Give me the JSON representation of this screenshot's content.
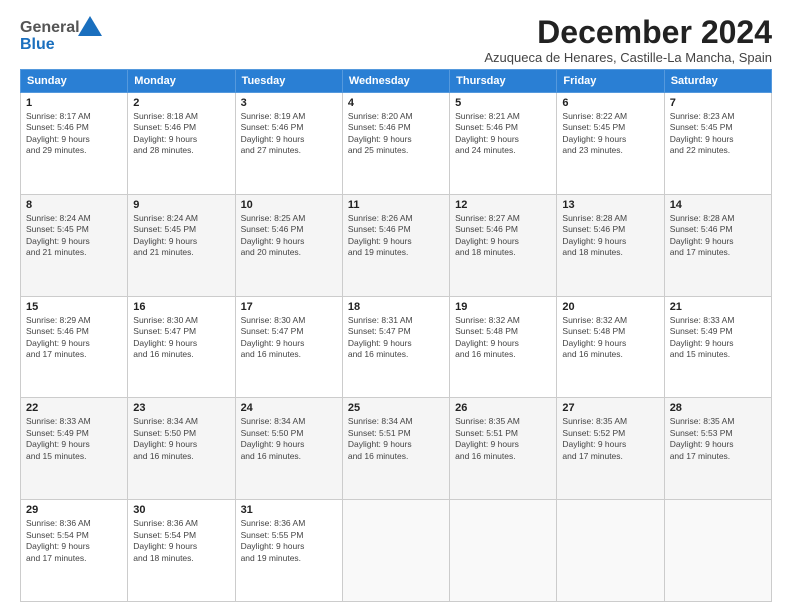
{
  "header": {
    "logo": {
      "line1": "General",
      "line2": "Blue"
    },
    "title": "December 2024",
    "location": "Azuqueca de Henares, Castille-La Mancha, Spain"
  },
  "weekdays": [
    "Sunday",
    "Monday",
    "Tuesday",
    "Wednesday",
    "Thursday",
    "Friday",
    "Saturday"
  ],
  "weeks": [
    [
      {
        "day": "1",
        "info": "Sunrise: 8:17 AM\nSunset: 5:46 PM\nDaylight: 9 hours\nand 29 minutes."
      },
      {
        "day": "2",
        "info": "Sunrise: 8:18 AM\nSunset: 5:46 PM\nDaylight: 9 hours\nand 28 minutes."
      },
      {
        "day": "3",
        "info": "Sunrise: 8:19 AM\nSunset: 5:46 PM\nDaylight: 9 hours\nand 27 minutes."
      },
      {
        "day": "4",
        "info": "Sunrise: 8:20 AM\nSunset: 5:46 PM\nDaylight: 9 hours\nand 25 minutes."
      },
      {
        "day": "5",
        "info": "Sunrise: 8:21 AM\nSunset: 5:46 PM\nDaylight: 9 hours\nand 24 minutes."
      },
      {
        "day": "6",
        "info": "Sunrise: 8:22 AM\nSunset: 5:45 PM\nDaylight: 9 hours\nand 23 minutes."
      },
      {
        "day": "7",
        "info": "Sunrise: 8:23 AM\nSunset: 5:45 PM\nDaylight: 9 hours\nand 22 minutes."
      }
    ],
    [
      {
        "day": "8",
        "info": "Sunrise: 8:24 AM\nSunset: 5:45 PM\nDaylight: 9 hours\nand 21 minutes."
      },
      {
        "day": "9",
        "info": "Sunrise: 8:24 AM\nSunset: 5:45 PM\nDaylight: 9 hours\nand 21 minutes."
      },
      {
        "day": "10",
        "info": "Sunrise: 8:25 AM\nSunset: 5:46 PM\nDaylight: 9 hours\nand 20 minutes."
      },
      {
        "day": "11",
        "info": "Sunrise: 8:26 AM\nSunset: 5:46 PM\nDaylight: 9 hours\nand 19 minutes."
      },
      {
        "day": "12",
        "info": "Sunrise: 8:27 AM\nSunset: 5:46 PM\nDaylight: 9 hours\nand 18 minutes."
      },
      {
        "day": "13",
        "info": "Sunrise: 8:28 AM\nSunset: 5:46 PM\nDaylight: 9 hours\nand 18 minutes."
      },
      {
        "day": "14",
        "info": "Sunrise: 8:28 AM\nSunset: 5:46 PM\nDaylight: 9 hours\nand 17 minutes."
      }
    ],
    [
      {
        "day": "15",
        "info": "Sunrise: 8:29 AM\nSunset: 5:46 PM\nDaylight: 9 hours\nand 17 minutes."
      },
      {
        "day": "16",
        "info": "Sunrise: 8:30 AM\nSunset: 5:47 PM\nDaylight: 9 hours\nand 16 minutes."
      },
      {
        "day": "17",
        "info": "Sunrise: 8:30 AM\nSunset: 5:47 PM\nDaylight: 9 hours\nand 16 minutes."
      },
      {
        "day": "18",
        "info": "Sunrise: 8:31 AM\nSunset: 5:47 PM\nDaylight: 9 hours\nand 16 minutes."
      },
      {
        "day": "19",
        "info": "Sunrise: 8:32 AM\nSunset: 5:48 PM\nDaylight: 9 hours\nand 16 minutes."
      },
      {
        "day": "20",
        "info": "Sunrise: 8:32 AM\nSunset: 5:48 PM\nDaylight: 9 hours\nand 16 minutes."
      },
      {
        "day": "21",
        "info": "Sunrise: 8:33 AM\nSunset: 5:49 PM\nDaylight: 9 hours\nand 15 minutes."
      }
    ],
    [
      {
        "day": "22",
        "info": "Sunrise: 8:33 AM\nSunset: 5:49 PM\nDaylight: 9 hours\nand 15 minutes."
      },
      {
        "day": "23",
        "info": "Sunrise: 8:34 AM\nSunset: 5:50 PM\nDaylight: 9 hours\nand 16 minutes."
      },
      {
        "day": "24",
        "info": "Sunrise: 8:34 AM\nSunset: 5:50 PM\nDaylight: 9 hours\nand 16 minutes."
      },
      {
        "day": "25",
        "info": "Sunrise: 8:34 AM\nSunset: 5:51 PM\nDaylight: 9 hours\nand 16 minutes."
      },
      {
        "day": "26",
        "info": "Sunrise: 8:35 AM\nSunset: 5:51 PM\nDaylight: 9 hours\nand 16 minutes."
      },
      {
        "day": "27",
        "info": "Sunrise: 8:35 AM\nSunset: 5:52 PM\nDaylight: 9 hours\nand 17 minutes."
      },
      {
        "day": "28",
        "info": "Sunrise: 8:35 AM\nSunset: 5:53 PM\nDaylight: 9 hours\nand 17 minutes."
      }
    ],
    [
      {
        "day": "29",
        "info": "Sunrise: 8:36 AM\nSunset: 5:54 PM\nDaylight: 9 hours\nand 17 minutes."
      },
      {
        "day": "30",
        "info": "Sunrise: 8:36 AM\nSunset: 5:54 PM\nDaylight: 9 hours\nand 18 minutes."
      },
      {
        "day": "31",
        "info": "Sunrise: 8:36 AM\nSunset: 5:55 PM\nDaylight: 9 hours\nand 19 minutes."
      },
      {
        "day": "",
        "info": ""
      },
      {
        "day": "",
        "info": ""
      },
      {
        "day": "",
        "info": ""
      },
      {
        "day": "",
        "info": ""
      }
    ]
  ]
}
